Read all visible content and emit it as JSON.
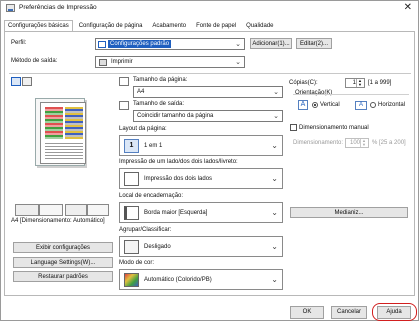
{
  "window": {
    "title": "Preferências de Impressão"
  },
  "tabs": [
    {
      "label": "Configurações básicas"
    },
    {
      "label": "Configuração de página"
    },
    {
      "label": "Acabamento"
    },
    {
      "label": "Fonte de papel"
    },
    {
      "label": "Qualidade"
    }
  ],
  "perfil": {
    "label": "Perfil:",
    "value": "Configurações padrão",
    "add_label": "Adicionar(1)...",
    "edit_label": "Editar(2)..."
  },
  "metodo": {
    "label": "Método de saída:",
    "value": "Imprimir"
  },
  "preview": {
    "caption": "A4 [Dimensionamento: Automático]"
  },
  "tamanho_pagina": {
    "label": "Tamanho da página:",
    "value": "A4"
  },
  "tamanho_saida": {
    "label": "Tamanho de saída:",
    "value": "Coincidir tamanho da página"
  },
  "copias": {
    "label": "Cópias(C):",
    "value": "1",
    "range": "[1 a 999]"
  },
  "orientacao": {
    "label": "Orientação(K)",
    "vertical": "Vertical",
    "horizontal": "Horizontal"
  },
  "layout": {
    "label": "Layout da página:",
    "value": "1 em 1"
  },
  "dimensionamento": {
    "label": "Dimensionamento manual",
    "field_label": "Dimensionamento:",
    "value": "100",
    "range": "% [25 a 200]"
  },
  "duplex": {
    "label": "Impressão de um lado/dos dois lados/livreto:",
    "value": "Impressão dos dois lados"
  },
  "encadernacao": {
    "label": "Local de encadernação:",
    "value": "Borda maior [Esquerda]",
    "margin_button": "Medianiz..."
  },
  "agrupar": {
    "label": "Agrupar/Classificar:",
    "value": "Desligado"
  },
  "cor": {
    "label": "Modo de cor:",
    "value": "Automático (Colorido/PB)"
  },
  "left_buttons": {
    "show": "Exibir configurações",
    "language": "Language Settings(W)...",
    "restore": "Restaurar padrões"
  },
  "footer": {
    "ok": "OK",
    "cancel": "Cancelar",
    "help": "Ajuda"
  },
  "colors": {
    "highlight": "#1f5fbf",
    "help_ring": "#d21f1f"
  }
}
